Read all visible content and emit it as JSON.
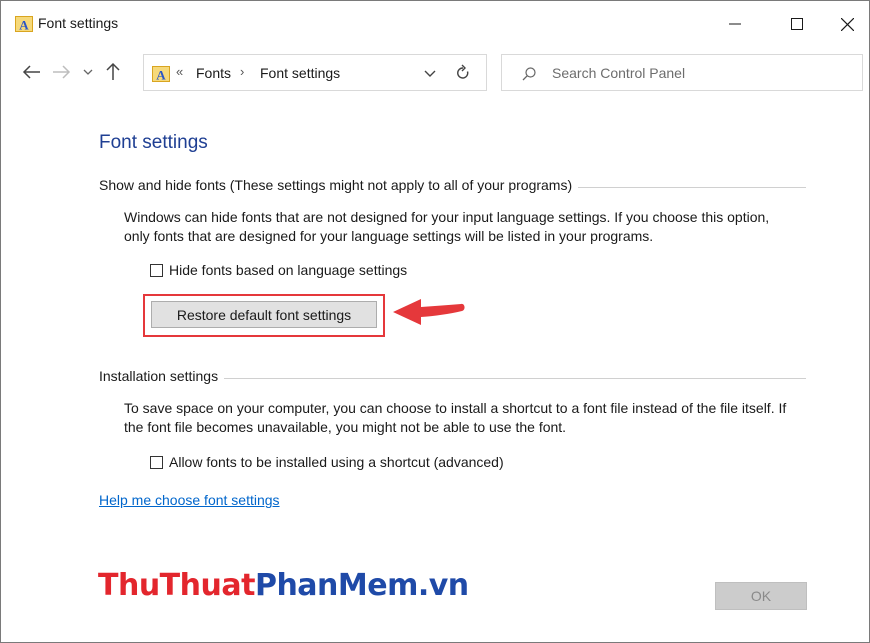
{
  "window": {
    "title": "Font settings",
    "app_icon": "fonts-folder-icon",
    "controls": [
      "minimize-icon",
      "maximize-icon",
      "close-icon"
    ]
  },
  "nav": {
    "back_icon": "back-arrow-icon",
    "forward_icon": "forward-arrow-icon",
    "recent_icon": "chevron-down-icon",
    "up_icon": "up-arrow-icon",
    "address": {
      "overflow": "«",
      "breadcrumbs": [
        "Fonts",
        "Font settings"
      ],
      "separator": "›"
    },
    "search_placeholder": "Search Control Panel"
  },
  "content": {
    "title": "Font settings",
    "show_hide": {
      "heading": "Show and hide fonts (These settings might not apply to all of your programs)",
      "description": "Windows can hide fonts that are not designed for your input language settings. If you choose this option, only fonts that are designed for your language settings will be listed in your programs.",
      "checkbox_label": "Hide fonts based on language settings",
      "checkbox_checked": false,
      "restore_button": "Restore default font settings"
    },
    "installation": {
      "heading": "Installation settings",
      "description": "To save space on your computer, you can choose to install a shortcut to a font file instead of the file itself. If the font file becomes unavailable, you might not be able to use the font.",
      "checkbox_label": "Allow fonts to be installed using a shortcut (advanced)",
      "checkbox_checked": false
    },
    "help_link": "Help me choose font settings"
  },
  "footer": {
    "watermark_part1": "ThuThuat",
    "watermark_part2": "PhanMem",
    "watermark_part3": ".vn",
    "ok_button": "OK"
  },
  "colors": {
    "highlight": "#e5383b",
    "link": "#0066cc",
    "title": "#1f3f93"
  }
}
